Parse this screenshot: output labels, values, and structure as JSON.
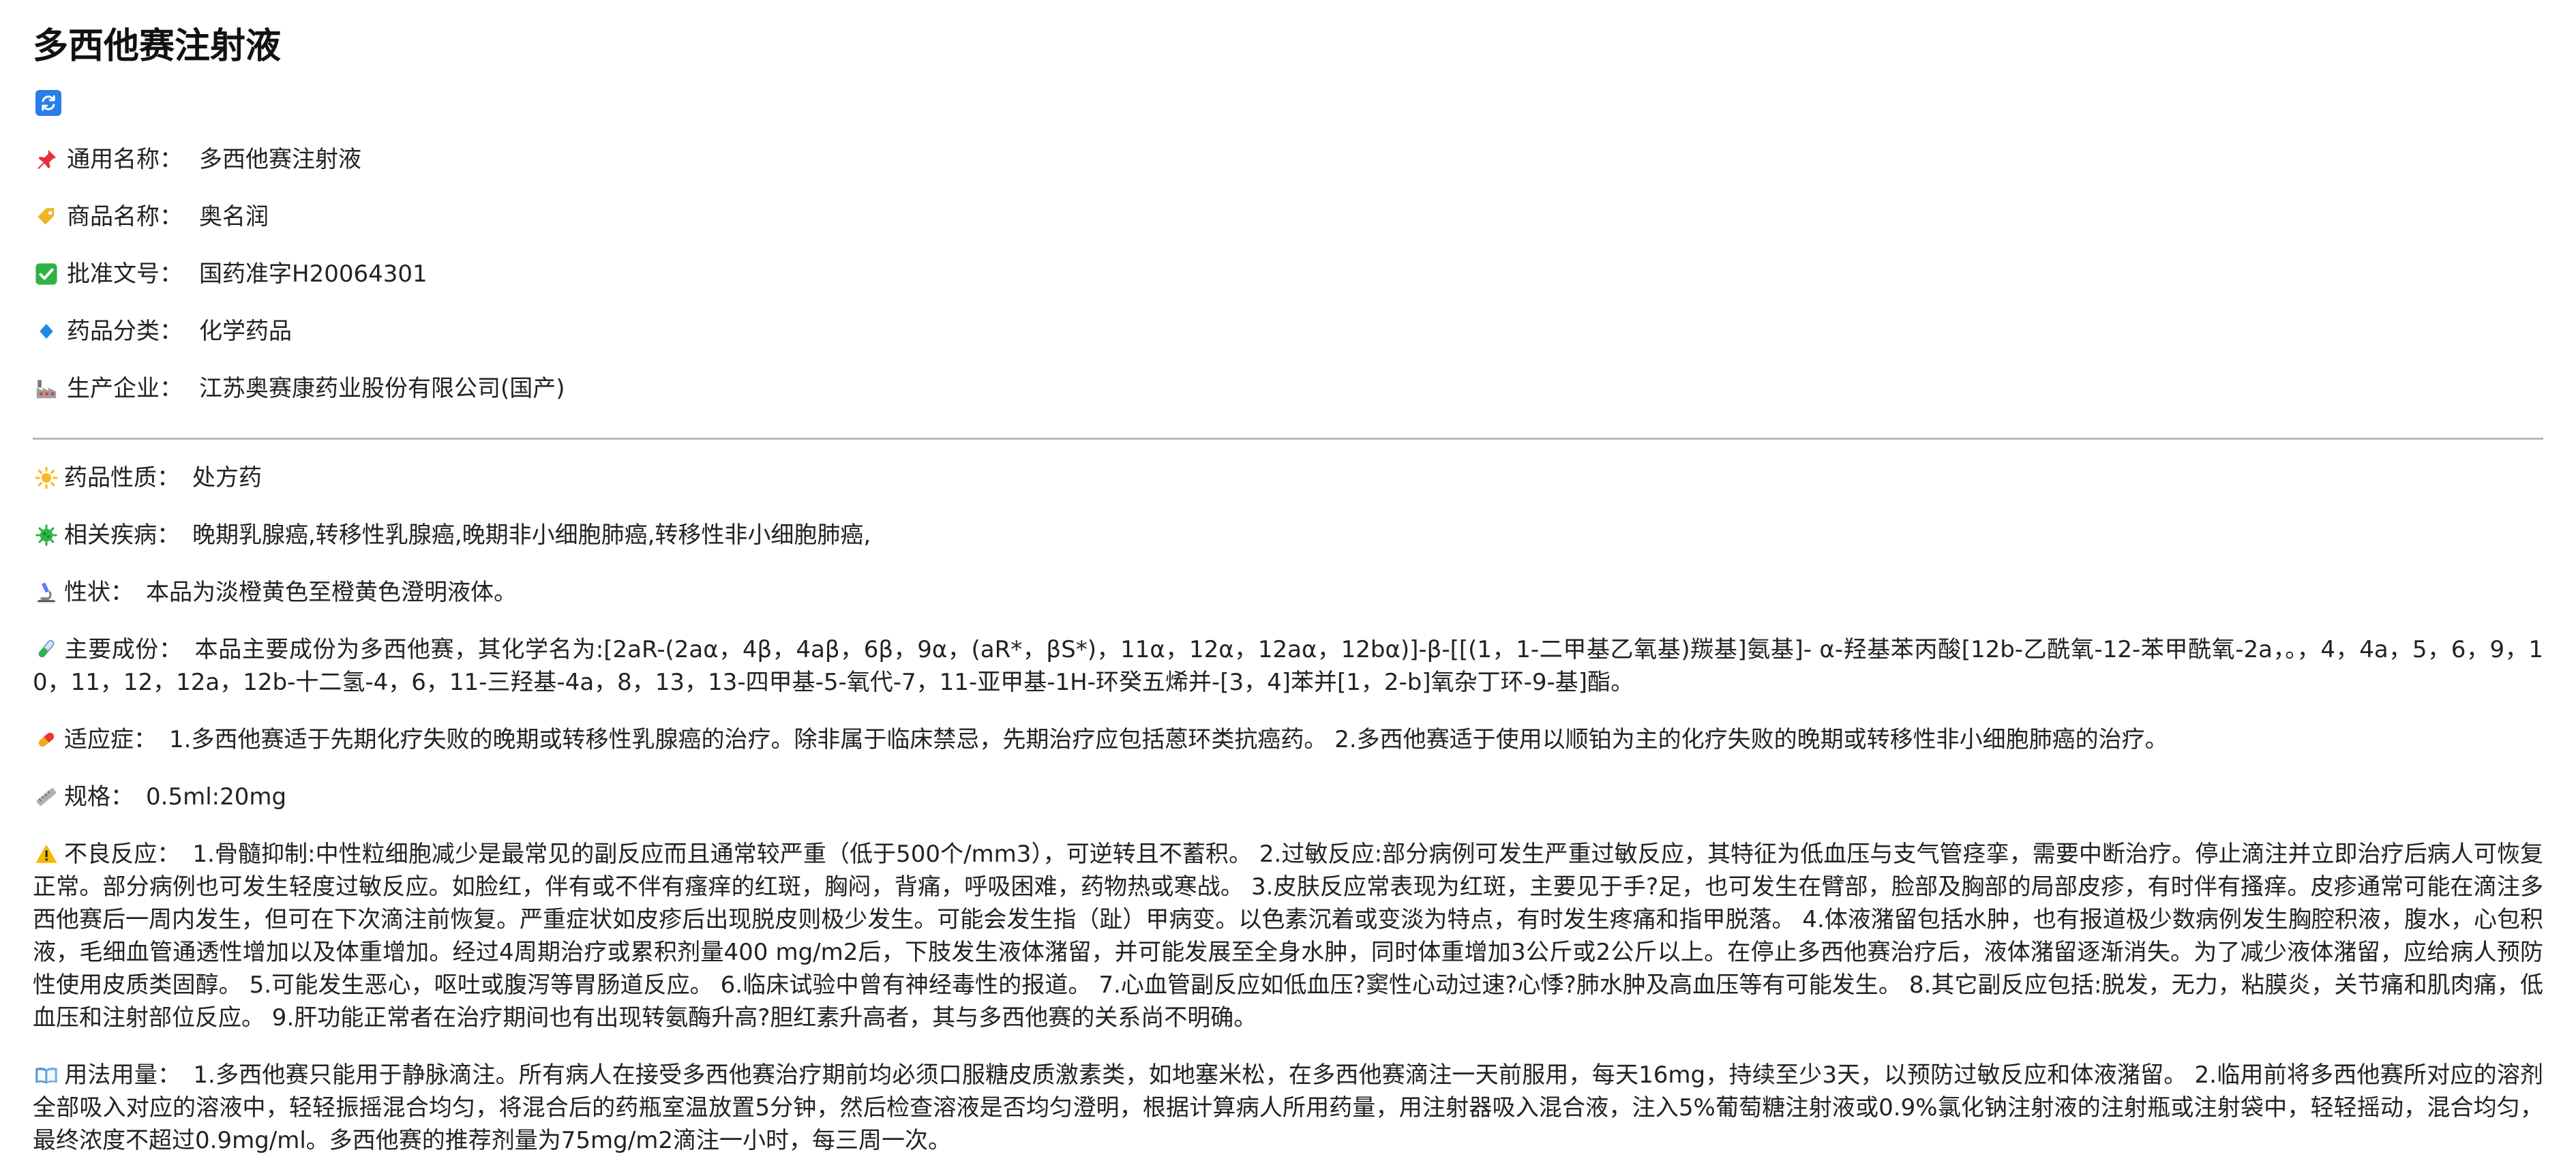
{
  "title": "多西他赛注射液",
  "basic_info": [
    {
      "icon": "pushpin-icon",
      "label": "通用名称：",
      "value": "多西他赛注射液"
    },
    {
      "icon": "tag-icon",
      "label": "商品名称：",
      "value": "奥名润"
    },
    {
      "icon": "checkmark-icon",
      "label": "批准文号：",
      "value": "国药准字H20064301"
    },
    {
      "icon": "diamond-icon",
      "label": "药品分类：",
      "value": "化学药品"
    },
    {
      "icon": "factory-icon",
      "label": "生产企业：",
      "value": "江苏奥赛康药业股份有限公司(国产)"
    }
  ],
  "details": [
    {
      "icon": "sun-icon",
      "label": "药品性质：",
      "value": "处方药"
    },
    {
      "icon": "microbe-icon",
      "label": "相关疾病：",
      "value": "晚期乳腺癌,转移性乳腺癌,晚期非小细胞肺癌,转移性非小细胞肺癌,"
    },
    {
      "icon": "microscope-icon",
      "label": "性状：",
      "value": "本品为淡橙黄色至橙黄色澄明液体。"
    },
    {
      "icon": "test-tube-icon",
      "label": "主要成份：",
      "value": "本品主要成份为多西他赛，其化学名为:[2aR-(2aα，4β，4aβ，6β，9α，(aR*，βS*)，11α，12α，12aα，12bα)]-β-[[(1，1-二甲基乙氧基)羰基]氨基]- α-羟基苯丙酸[12b-乙酰氧-12-苯甲酰氧-2a，。，4，4a，5，6，9，10，11，12，12a，12b-十二氢-4，6，11-三羟基-4a，8，13，13-四甲基-5-氧代-7，11-亚甲基-1H-环癸五烯并-[3，4]苯并[1，2-b]氧杂丁环-9-基]酯。"
    },
    {
      "icon": "pill-icon",
      "label": "适应症：",
      "value": "1.多西他赛适于先期化疗失败的晚期或转移性乳腺癌的治疗。除非属于临床禁忌，先期治疗应包括蒽环类抗癌药。 2.多西他赛适于使用以顺铂为主的化疗失败的晚期或转移性非小细胞肺癌的治疗。"
    },
    {
      "icon": "ruler-icon",
      "label": "规格：",
      "value": "0.5ml:20mg"
    },
    {
      "icon": "warning-icon",
      "label": "不良反应：",
      "value": "1.骨髓抑制:中性粒细胞减少是最常见的副反应而且通常较严重（低于500个/mm3），可逆转且不蓄积。 2.过敏反应:部分病例可发生严重过敏反应，其特征为低血压与支气管痉挛，需要中断治疗。停止滴注并立即治疗后病人可恢复正常。部分病例也可发生轻度过敏反应。如脸红，伴有或不伴有瘙痒的红斑，胸闷，背痛，呼吸困难，药物热或寒战。 3.皮肤反应常表现为红斑，主要见于手?足，也可发生在臂部，脸部及胸部的局部皮疹，有时伴有搔痒。皮疹通常可能在滴注多西他赛后一周内发生，但可在下次滴注前恢复。严重症状如皮疹后出现脱皮则极少发生。可能会发生指（趾）甲病变。以色素沉着或变淡为特点，有时发生疼痛和指甲脱落。 4.体液潴留包括水肿，也有报道极少数病例发生胸腔积液，腹水，心包积液，毛细血管通透性增加以及体重增加。经过4周期治疗或累积剂量400 mg/m2后，下肢发生液体潴留，并可能发展至全身水肿，同时体重增加3公斤或2公斤以上。在停止多西他赛治疗后，液体潴留逐渐消失。为了减少液体潴留，应给病人预防性使用皮质类固醇。 5.可能发生恶心，呕吐或腹泻等胃肠道反应。 6.临床试验中曾有神经毒性的报道。 7.心血管副反应如低血压?窦性心动过速?心悸?肺水肿及高血压等有可能发生。 8.其它副反应包括:脱发，无力，粘膜炎，关节痛和肌肉痛，低血压和注射部位反应。 9.肝功能正常者在治疗期间也有出现转氨酶升高?胆红素升高者，其与多西他赛的关系尚不明确。"
    },
    {
      "icon": "open-book-icon",
      "label": "用法用量：",
      "value": "1.多西他赛只能用于静脉滴注。所有病人在接受多西他赛治疗期前均必须口服糖皮质激素类，如地塞米松，在多西他赛滴注一天前服用，每天16mg，持续至少3天，以预防过敏反应和体液潴留。 2.临用前将多西他赛所对应的溶剂全部吸入对应的溶液中，轻轻振摇混合均匀，将混合后的药瓶室温放置5分钟，然后检查溶液是否均匀澄明，根据计算病人所用药量，用注射器吸入混合液，注入5%葡萄糖注射液或0.9%氯化钠注射液的注射瓶或注射袋中，轻轻摇动，混合均匀，最终浓度不超过0.9mg/ml。多西他赛的推荐剂量为75mg/m2滴注一小时，每三周一次。"
    }
  ]
}
